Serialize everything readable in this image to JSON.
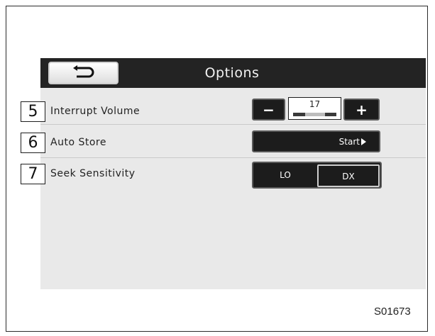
{
  "screen": {
    "title": "Options",
    "back_button": {
      "icon": "back-arrow-icon"
    }
  },
  "rows": [
    {
      "number": "5",
      "label": "Interrupt Volume",
      "control": {
        "decrease_label": "−",
        "increase_label": "+",
        "value": "17",
        "level_fraction": 0.5
      }
    },
    {
      "number": "6",
      "label": "Auto Store",
      "control": {
        "button_label": "Start",
        "arrow_icon": "play-arrow-icon"
      }
    },
    {
      "number": "7",
      "label": "Seek Sensitivity",
      "control": {
        "options": [
          "LO",
          "DX"
        ],
        "selected": "DX"
      }
    }
  ],
  "figure_code": "S01673",
  "colors": {
    "title_bar": "#232323",
    "screen_background": "#e9e9e9",
    "button_dark": "#1c1c1c"
  }
}
